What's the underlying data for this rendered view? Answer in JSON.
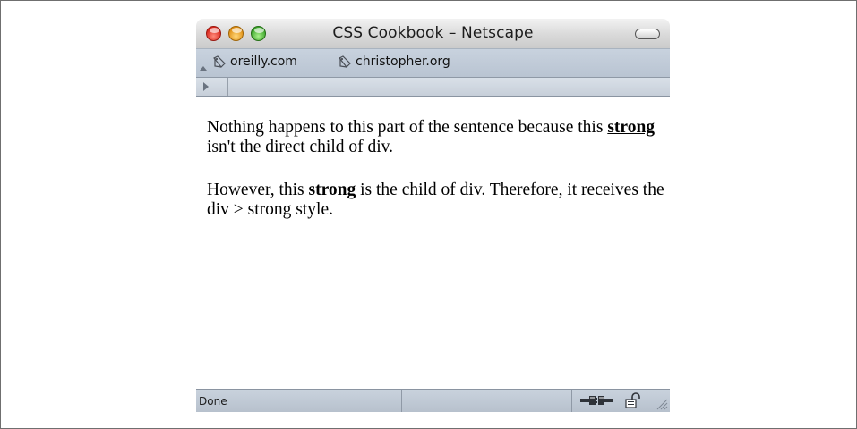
{
  "window": {
    "title": "CSS Cookbook – Netscape"
  },
  "bookmarks": [
    {
      "label": "oreilly.com",
      "icon": "bookmark-icon"
    },
    {
      "label": "christopher.org",
      "icon": "bookmark-icon"
    }
  ],
  "content": {
    "para1": {
      "before": "Nothing happens to this part of the sentence because this ",
      "strong": "strong",
      "after": " isn't the direct child of div."
    },
    "para2": {
      "before": "However, this ",
      "strong": "strong",
      "after": " is the child of div. Therefore, it receives the div > strong style."
    }
  },
  "status": {
    "text": "Done"
  },
  "colors": {
    "close": "#d8261b",
    "minimize": "#e08f12",
    "zoom": "#3ba52a",
    "chrome": "#c8d2de"
  }
}
